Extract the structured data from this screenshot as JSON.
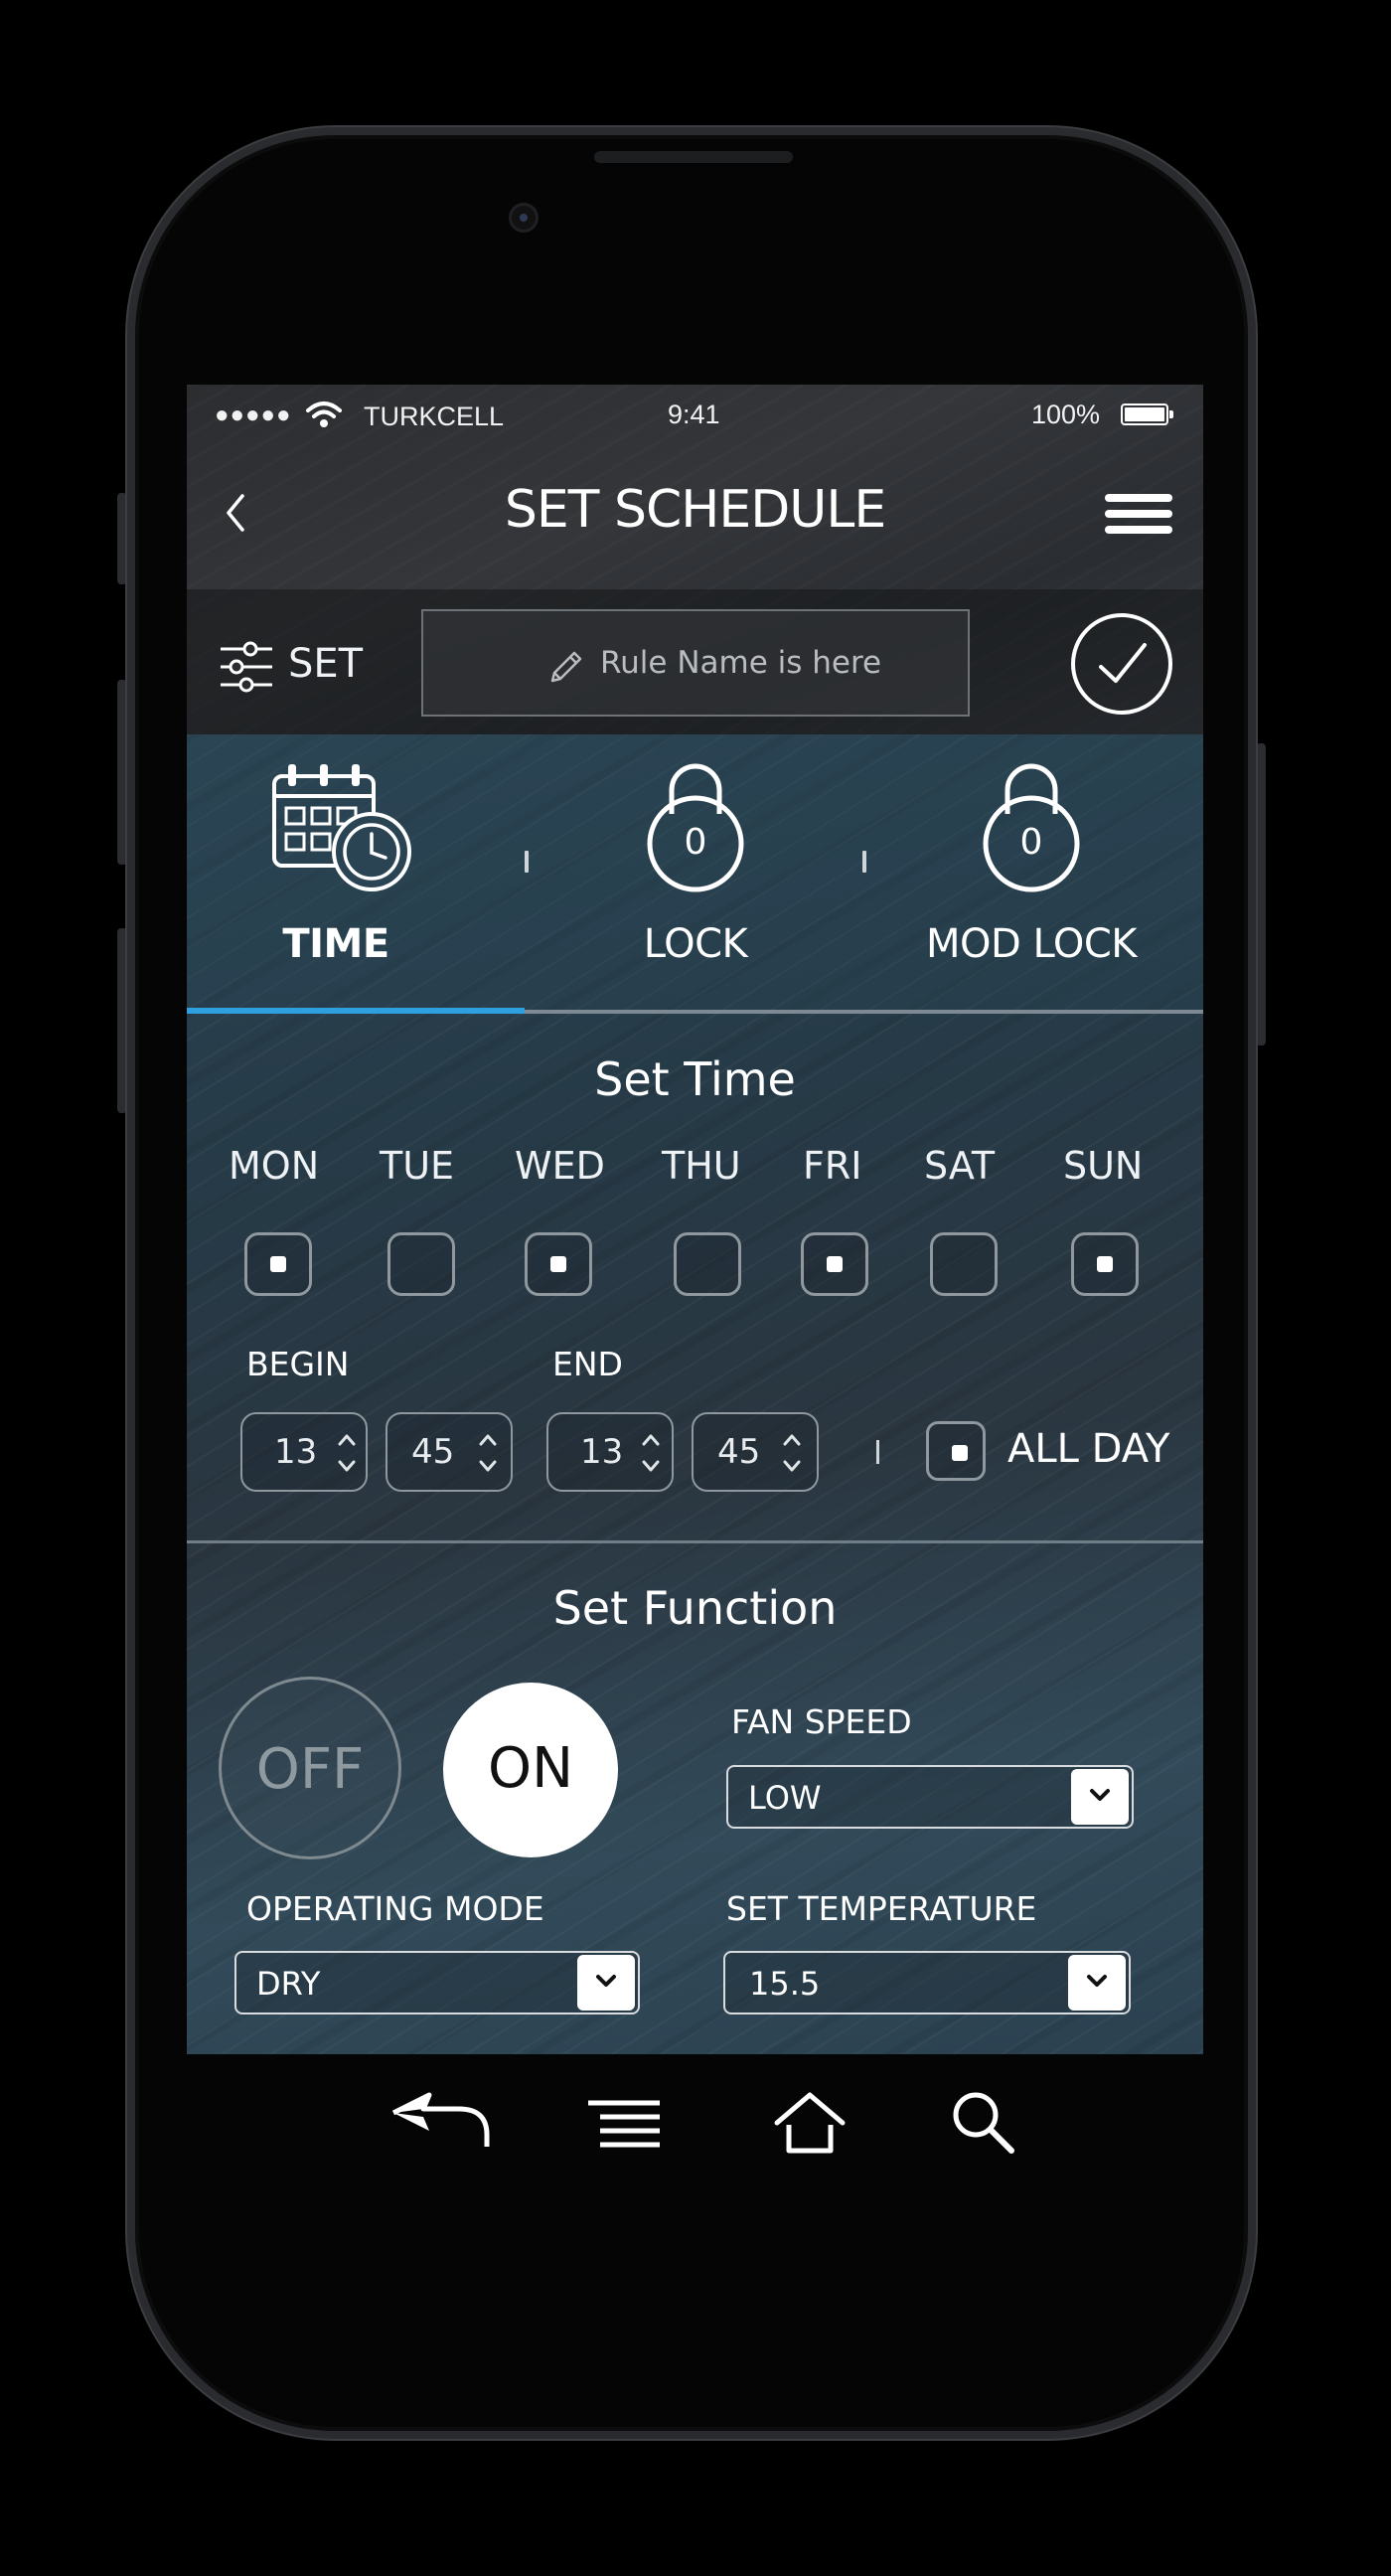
{
  "status_bar": {
    "carrier": "TURKCELL",
    "time": "9:41",
    "battery": "100%"
  },
  "header": {
    "title": "SET SCHEDULE"
  },
  "rule_bar": {
    "set_label": "SET",
    "rule_placeholder": "Rule Name is here"
  },
  "tabs": [
    {
      "label": "TIME",
      "active": true,
      "icon": "calendar-clock-icon"
    },
    {
      "label": "LOCK",
      "active": false,
      "icon": "padlock-icon",
      "badge": "0"
    },
    {
      "label": "MOD LOCK",
      "active": false,
      "icon": "padlock-icon",
      "badge": "0"
    }
  ],
  "set_time": {
    "heading": "Set Time",
    "days": [
      {
        "label": "MON",
        "checked": true
      },
      {
        "label": "TUE",
        "checked": false
      },
      {
        "label": "WED",
        "checked": true
      },
      {
        "label": "THU",
        "checked": false
      },
      {
        "label": "FRI",
        "checked": true
      },
      {
        "label": "SAT",
        "checked": false
      },
      {
        "label": "SUN",
        "checked": true
      }
    ],
    "begin_label": "BEGIN",
    "end_label": "END",
    "begin_hour": "13",
    "begin_minute": "45",
    "end_hour": "13",
    "end_minute": "45",
    "all_day_label": "ALL DAY",
    "all_day_checked": true
  },
  "set_function": {
    "heading": "Set Function",
    "off_label": "OFF",
    "on_label": "ON",
    "power_state": "ON",
    "fan_speed_label": "FAN SPEED",
    "fan_speed_value": "LOW",
    "operating_mode_label": "OPERATING MODE",
    "operating_mode_value": "DRY",
    "set_temperature_label": "SET TEMPERATURE",
    "set_temperature_value": "15.5"
  },
  "colors": {
    "accent": "#2ea0e0",
    "background": "#000000"
  }
}
